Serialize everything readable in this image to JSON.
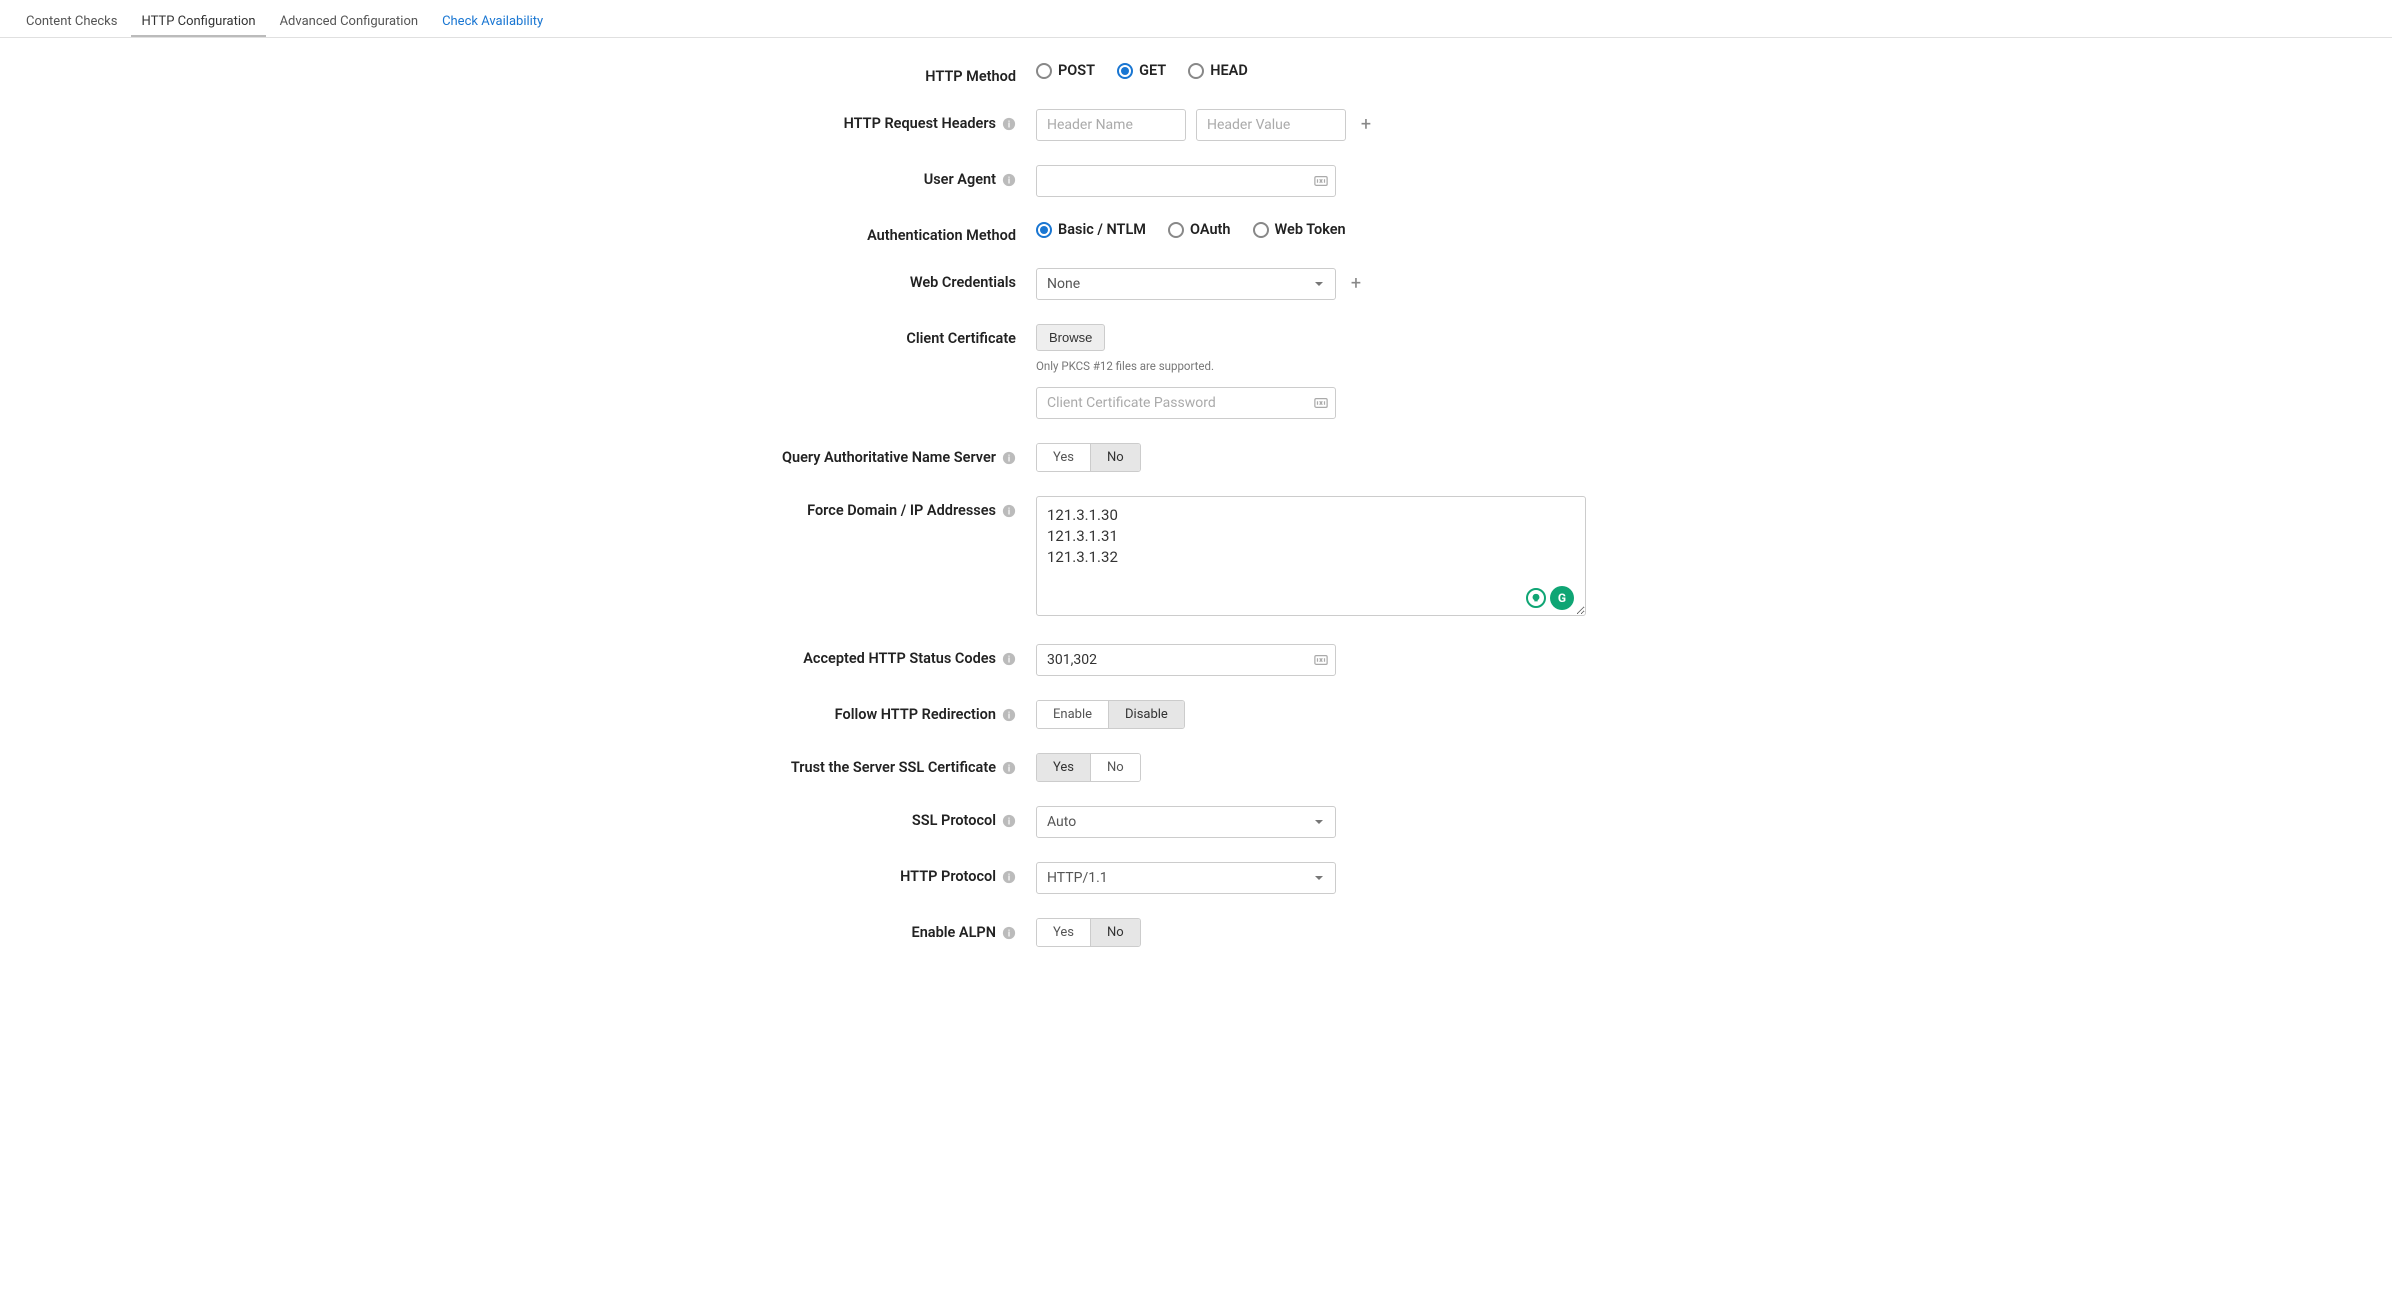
{
  "tabs": {
    "content_checks": "Content Checks",
    "http_config": "HTTP Configuration",
    "advanced_config": "Advanced Configuration",
    "check_availability": "Check Availability"
  },
  "labels": {
    "http_method": "HTTP Method",
    "http_headers": "HTTP Request Headers",
    "user_agent": "User Agent",
    "auth_method": "Authentication Method",
    "web_credentials": "Web Credentials",
    "client_cert": "Client Certificate",
    "query_ans": "Query Authoritative Name Server",
    "force_ip": "Force Domain / IP Addresses",
    "status_codes": "Accepted HTTP Status Codes",
    "follow_redir": "Follow HTTP Redirection",
    "trust_ssl": "Trust the Server SSL Certificate",
    "ssl_protocol": "SSL Protocol",
    "http_protocol": "HTTP Protocol",
    "enable_alpn": "Enable ALPN"
  },
  "http_method": {
    "post": "POST",
    "get": "GET",
    "head": "HEAD",
    "selected": "GET"
  },
  "headers": {
    "name_placeholder": "Header Name",
    "value_placeholder": "Header Value"
  },
  "user_agent_value": "",
  "auth_method": {
    "basic": "Basic / NTLM",
    "oauth": "OAuth",
    "webtoken": "Web Token",
    "selected": "Basic / NTLM"
  },
  "web_credentials": {
    "value": "None"
  },
  "client_cert": {
    "browse": "Browse",
    "hint": "Only PKCS #12 files are supported.",
    "password_placeholder": "Client Certificate Password",
    "password_value": ""
  },
  "yes": "Yes",
  "no": "No",
  "enable": "Enable",
  "disable": "Disable",
  "query_ans_selected": "No",
  "force_ip_value": "121.3.1.30\n121.3.1.31\n121.3.1.32",
  "status_codes_value": "301,302",
  "follow_redir_selected": "Disable",
  "trust_ssl_selected": "Yes",
  "ssl_protocol": {
    "value": "Auto"
  },
  "http_protocol": {
    "value": "HTTP/1.1"
  },
  "enable_alpn_selected": "No",
  "grammarly_letter": "G"
}
